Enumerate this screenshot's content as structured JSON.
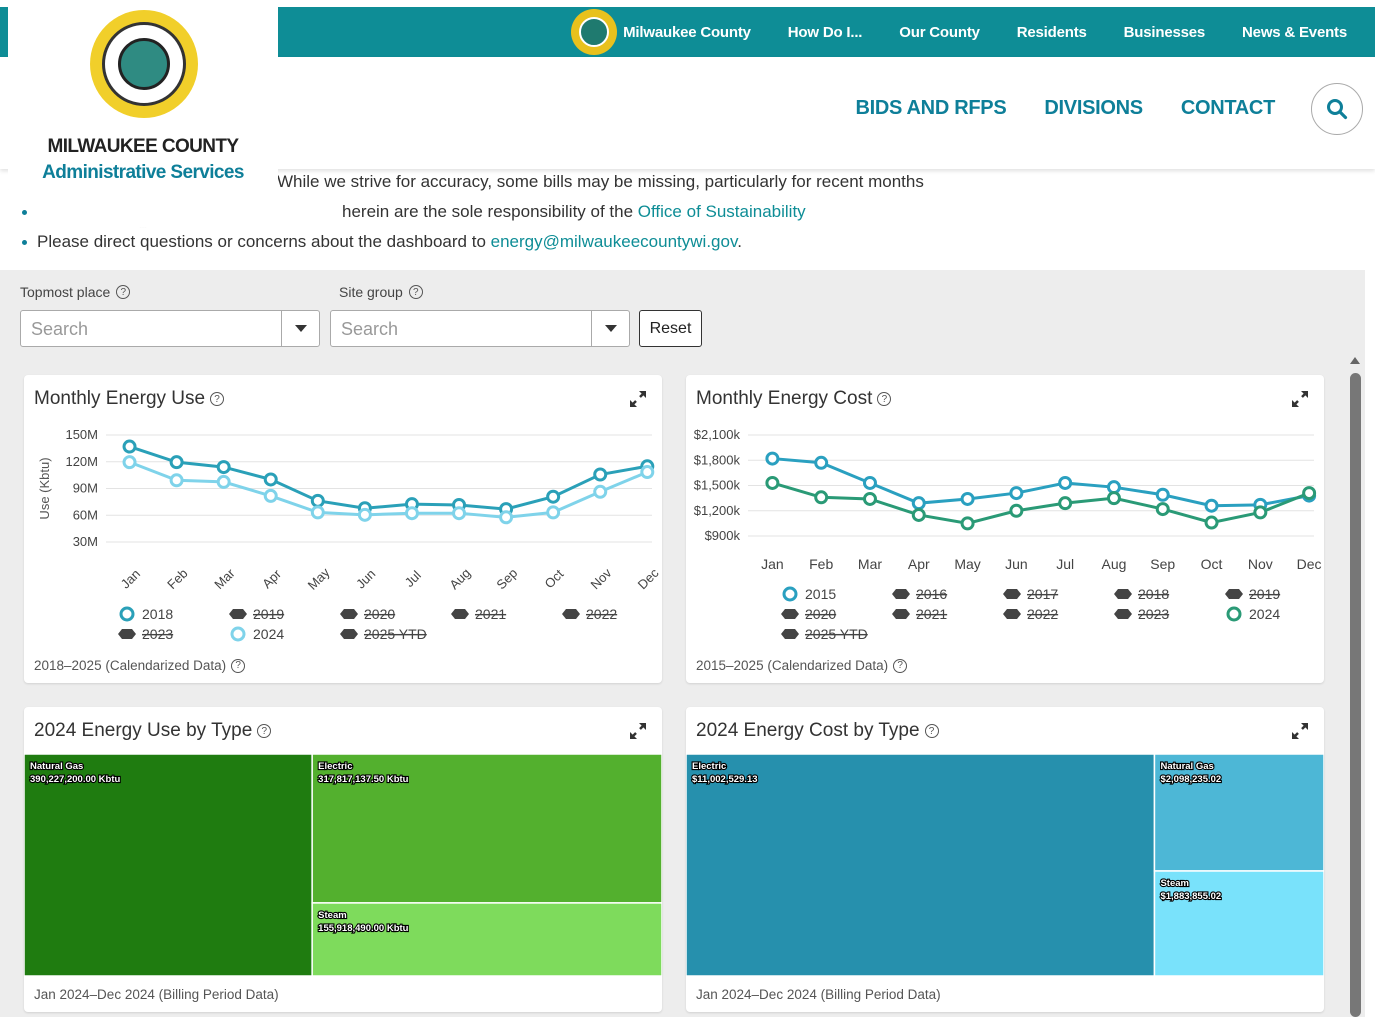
{
  "topnav": {
    "brand": "Milwaukee County",
    "items": [
      "How Do I...",
      "Our County",
      "Residents",
      "Businesses",
      "News & Events"
    ]
  },
  "mainnav": {
    "items": [
      "BIDS AND RFPS",
      "DIVISIONS",
      "CONTACT"
    ]
  },
  "logo": {
    "line1": "MILWAUKEE COUNTY",
    "line2": "Administrative Services"
  },
  "bullets": {
    "b1": "While we strive for accuracy, some bills may be missing, particularly for recent months",
    "b2_prefix": "herein are the sole responsibility of the ",
    "b2_link": "Office of Sustainability",
    "b3_prefix": "Please direct questions or concerns about the dashboard to ",
    "b3_link": "energy@milwaukeecountywi.gov",
    "b3_suffix": "."
  },
  "filters": {
    "topmost_label": "Topmost place",
    "site_label": "Site group",
    "placeholder": "Search",
    "reset": "Reset"
  },
  "colors": {
    "teal": "#0e8d96",
    "series_2018": "#2aa0b8",
    "series_2024_use": "#7fd3ea",
    "series_2015": "#2aa0c0",
    "series_2024_cost": "#2a9a76",
    "gas_green": "#1f7c10",
    "electric_green": "#53b02e",
    "steam_green": "#7edb5c",
    "electric_blue": "#2690ad",
    "gas_blue": "#4db7d6",
    "steam_blue": "#79e2fb"
  },
  "chart_data": [
    {
      "type": "line",
      "title": "Monthly Energy Use",
      "ylabel": "Use (Kbtu)",
      "categories": [
        "Jan",
        "Feb",
        "Mar",
        "Apr",
        "May",
        "Jun",
        "Jul",
        "Aug",
        "Sep",
        "Oct",
        "Nov",
        "Dec"
      ],
      "ytick_labels": [
        "150M",
        "120M",
        "90M",
        "60M",
        "30M"
      ],
      "ylim": [
        20000000,
        150000000
      ],
      "series": [
        {
          "name": "2018",
          "values": [
            136000000,
            117000000,
            111000000,
            96000000,
            70000000,
            61000000,
            66000000,
            65000000,
            60000000,
            75000000,
            102000000,
            112000000
          ]
        },
        {
          "name": "2024",
          "values": [
            117000000,
            95000000,
            93000000,
            76000000,
            56000000,
            53000000,
            55000000,
            55000000,
            50000000,
            56000000,
            81000000,
            105000000
          ]
        }
      ],
      "legend": [
        {
          "label": "2018",
          "active": true
        },
        {
          "label": "2019",
          "active": false
        },
        {
          "label": "2020",
          "active": false
        },
        {
          "label": "2021",
          "active": false
        },
        {
          "label": "2022",
          "active": false
        },
        {
          "label": "2023",
          "active": false
        },
        {
          "label": "2024",
          "active": true
        },
        {
          "label": "2025 YTD",
          "active": false
        }
      ],
      "footer": "2018–2025 (Calendarized Data)"
    },
    {
      "type": "line",
      "title": "Monthly Energy Cost",
      "categories": [
        "Jan",
        "Feb",
        "Mar",
        "Apr",
        "May",
        "Jun",
        "Jul",
        "Aug",
        "Sep",
        "Oct",
        "Nov",
        "Dec"
      ],
      "ytick_labels": [
        "$2,100k",
        "$1,800k",
        "$1,500k",
        "$1,200k",
        "$900k"
      ],
      "ylim": [
        900000,
        2100000
      ],
      "series": [
        {
          "name": "2015",
          "values": [
            1820000,
            1770000,
            1530000,
            1290000,
            1340000,
            1410000,
            1530000,
            1480000,
            1390000,
            1260000,
            1270000,
            1380000
          ]
        },
        {
          "name": "2024",
          "values": [
            1530000,
            1360000,
            1340000,
            1150000,
            1050000,
            1200000,
            1290000,
            1350000,
            1220000,
            1060000,
            1180000,
            1410000
          ]
        }
      ],
      "legend": [
        {
          "label": "2015",
          "active": true
        },
        {
          "label": "2016",
          "active": false
        },
        {
          "label": "2017",
          "active": false
        },
        {
          "label": "2018",
          "active": false
        },
        {
          "label": "2019",
          "active": false
        },
        {
          "label": "2020",
          "active": false
        },
        {
          "label": "2021",
          "active": false
        },
        {
          "label": "2022",
          "active": false
        },
        {
          "label": "2023",
          "active": false
        },
        {
          "label": "2024",
          "active": true
        },
        {
          "label": "2025 YTD",
          "active": false
        }
      ],
      "footer": "2015–2025 (Calendarized Data)"
    },
    {
      "type": "treemap",
      "title": "2024 Energy Use by Type",
      "items": [
        {
          "name": "Natural Gas",
          "label": "390,227,200.00 Kbtu",
          "value": 390227200.0
        },
        {
          "name": "Electric",
          "label": "317,817,137.50 Kbtu",
          "value": 317817137.5
        },
        {
          "name": "Steam",
          "label": "155,918,490.00 Kbtu",
          "value": 155918490.0
        }
      ],
      "footer": "Jan 2024–Dec 2024 (Billing Period Data)"
    },
    {
      "type": "treemap",
      "title": "2024 Energy Cost by Type",
      "items": [
        {
          "name": "Electric",
          "label": "$11,002,529.13",
          "value": 11002529.13
        },
        {
          "name": "Natural Gas",
          "label": "$2,098,235.02",
          "value": 2098235.02
        },
        {
          "name": "Steam",
          "label": "$1,883,855.02",
          "value": 1883855.02
        }
      ],
      "footer": "Jan 2024–Dec 2024 (Billing Period Data)"
    }
  ]
}
